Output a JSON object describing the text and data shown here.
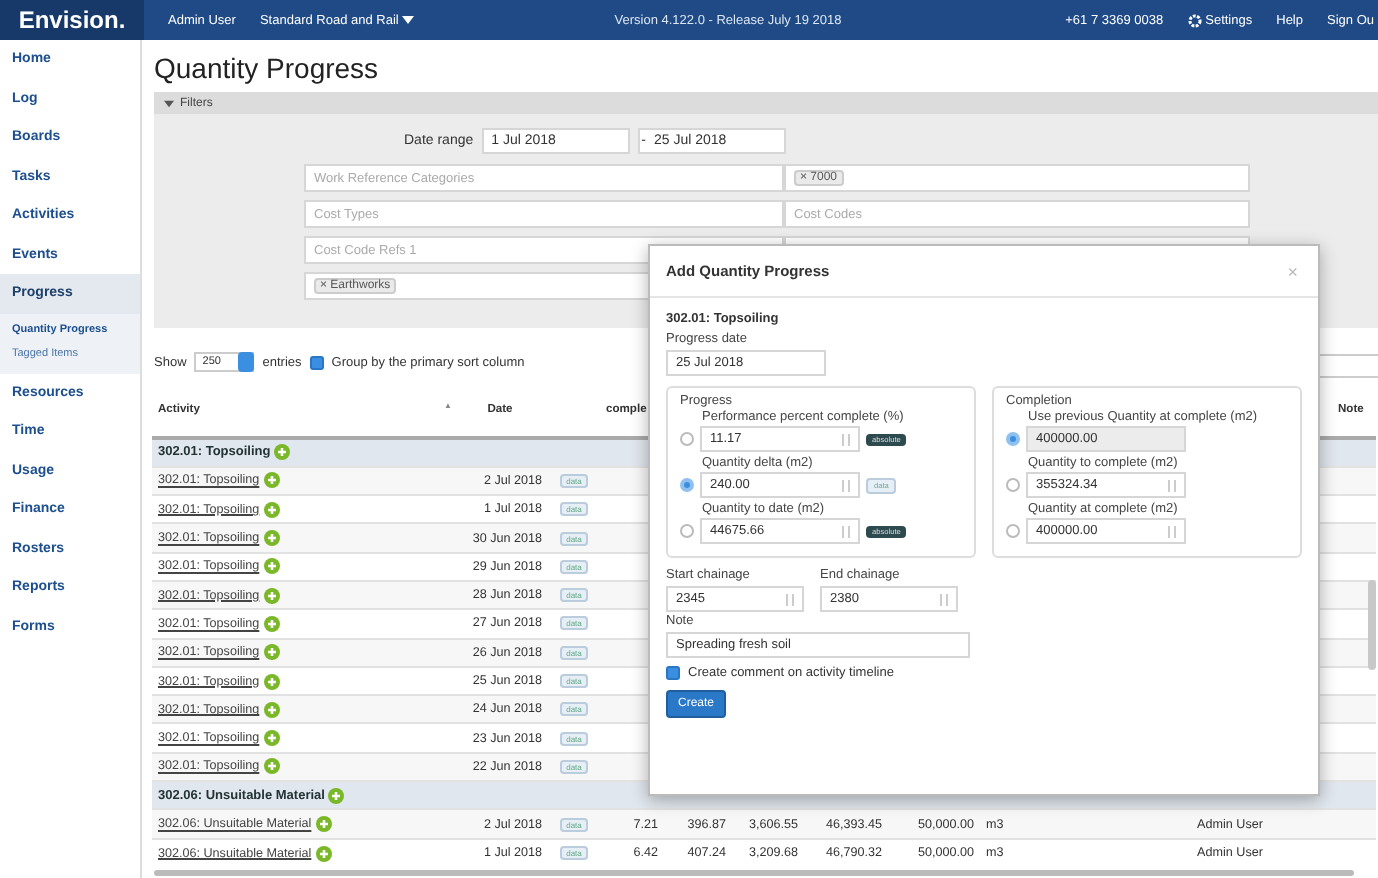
{
  "topbar": {
    "brand": "Envision.",
    "user": "Admin User",
    "project": "Standard Road and Rail",
    "version": "Version 4.122.0 - Release July 19 2018",
    "phone": "+61 7 3369 0038",
    "links": [
      {
        "kind": "settings",
        "label": "Settings"
      },
      {
        "kind": "plain",
        "label": "Help"
      },
      {
        "kind": "plain",
        "label": "Sign Ou"
      }
    ]
  },
  "sidebar": {
    "items": [
      {
        "label": "Home",
        "selected": false
      },
      {
        "label": "Log",
        "selected": false
      },
      {
        "label": "Boards",
        "selected": false
      },
      {
        "label": "Tasks",
        "selected": false
      },
      {
        "label": "Activities",
        "selected": false
      },
      {
        "label": "Events",
        "selected": false
      },
      {
        "label": "Progress",
        "selected": true,
        "children": [
          {
            "label": "Quantity Progress",
            "selected": true
          },
          {
            "label": "Tagged Items",
            "selected": false
          }
        ]
      },
      {
        "label": "Resources",
        "selected": false
      },
      {
        "label": "Time",
        "selected": false
      },
      {
        "label": "Usage",
        "selected": false
      },
      {
        "label": "Finance",
        "selected": false
      },
      {
        "label": "Rosters",
        "selected": false
      },
      {
        "label": "Reports",
        "selected": false
      },
      {
        "label": "Forms",
        "selected": false
      }
    ]
  },
  "page_title": "Quantity Progress",
  "filters": {
    "title": "Filters",
    "expanded": true,
    "date_label": "Date range",
    "date_from": "1 Jul 2018",
    "date_sep": "-",
    "date_to": "25 Jul 2018",
    "fields": [
      {
        "placeholder": "Work Reference Categories"
      },
      {
        "tag": "× 7000"
      },
      {
        "placeholder": "Cost Types"
      },
      {
        "placeholder": "Cost Codes"
      },
      {
        "placeholder": "Cost Code Refs 1"
      },
      {
        "tag": "× Earthworks"
      }
    ]
  },
  "length": {
    "show": "Show",
    "value": "250",
    "entries": "entries",
    "group_label": "Group by the primary sort column",
    "group_checked": true
  },
  "table": {
    "sort_icon": "▲",
    "columns": [
      "Activity",
      "Date",
      "",
      "comple",
      "",
      "",
      "",
      "",
      "",
      "",
      "",
      "",
      "",
      "Note"
    ],
    "groups": [
      {
        "name": "302.01: Topsoiling",
        "rows": [
          {
            "activity": "302.01: Topsoiling",
            "date": "2 Jul 2018",
            "badge": "data"
          },
          {
            "activity": "302.01: Topsoiling",
            "date": "1 Jul 2018",
            "badge": "data"
          },
          {
            "activity": "302.01: Topsoiling",
            "date": "30 Jun 2018",
            "badge": "data"
          },
          {
            "activity": "302.01: Topsoiling",
            "date": "29 Jun 2018",
            "badge": "data"
          },
          {
            "activity": "302.01: Topsoiling",
            "date": "28 Jun 2018",
            "badge": "data"
          },
          {
            "activity": "302.01: Topsoiling",
            "date": "27 Jun 2018",
            "badge": "data"
          },
          {
            "activity": "302.01: Topsoiling",
            "date": "26 Jun 2018",
            "badge": "data"
          },
          {
            "activity": "302.01: Topsoiling",
            "date": "25 Jun 2018",
            "badge": "data"
          },
          {
            "activity": "302.01: Topsoiling",
            "date": "24 Jun 2018",
            "badge": "data"
          },
          {
            "activity": "302.01: Topsoiling",
            "date": "23 Jun 2018",
            "badge": "data"
          },
          {
            "activity": "302.01: Topsoiling",
            "date": "22 Jun 2018",
            "badge": "data"
          }
        ]
      },
      {
        "name": "302.06: Unsuitable Material",
        "rows": [
          {
            "activity": "302.06: Unsuitable Material",
            "date": "2 Jul 2018",
            "badge": "data",
            "values": [
              "7.21",
              "396.87",
              "3,606.55",
              "46,393.45",
              "50,000.00",
              "m3"
            ],
            "user": "Admin User"
          },
          {
            "activity": "302.06: Unsuitable Material",
            "date": "1 Jul 2018",
            "badge": "data",
            "values": [
              "6.42",
              "407.24",
              "3,209.68",
              "46,790.32",
              "50,000.00",
              "m3"
            ],
            "user": "Admin User"
          }
        ]
      }
    ]
  },
  "modal": {
    "title": "Add Quantity Progress",
    "close": "×",
    "activity": "302.01: Topsoiling",
    "date_label": "Progress date",
    "date_value": "25 Jul 2018",
    "progress": {
      "legend": "Progress",
      "options": [
        {
          "label": "Performance percent complete (%)",
          "value": "11.17",
          "selected": false,
          "badge": "absolute",
          "badge_dark": true
        },
        {
          "label": "Quantity delta (m2)",
          "value": "240.00",
          "selected": true,
          "badge": "data",
          "badge_dark": false
        },
        {
          "label": "Quantity to date (m2)",
          "value": "44675.66",
          "selected": false,
          "badge": "absolute",
          "badge_dark": true
        }
      ]
    },
    "completion": {
      "legend": "Completion",
      "options": [
        {
          "label": "Use previous Quantity at complete (m2)",
          "value": "400000.00",
          "selected": true,
          "disabled": true
        },
        {
          "label": "Quantity to complete (m2)",
          "value": "355324.34",
          "selected": false,
          "disabled": false
        },
        {
          "label": "Quantity at complete (m2)",
          "value": "400000.00",
          "selected": false,
          "disabled": false
        }
      ]
    },
    "start_label": "Start chainage",
    "start_value": "2345",
    "end_label": "End chainage",
    "end_value": "2380",
    "note_label": "Note",
    "note_value": "Spreading fresh soil",
    "comment_label": "Create comment on activity timeline",
    "comment_checked": true,
    "create": "Create"
  }
}
